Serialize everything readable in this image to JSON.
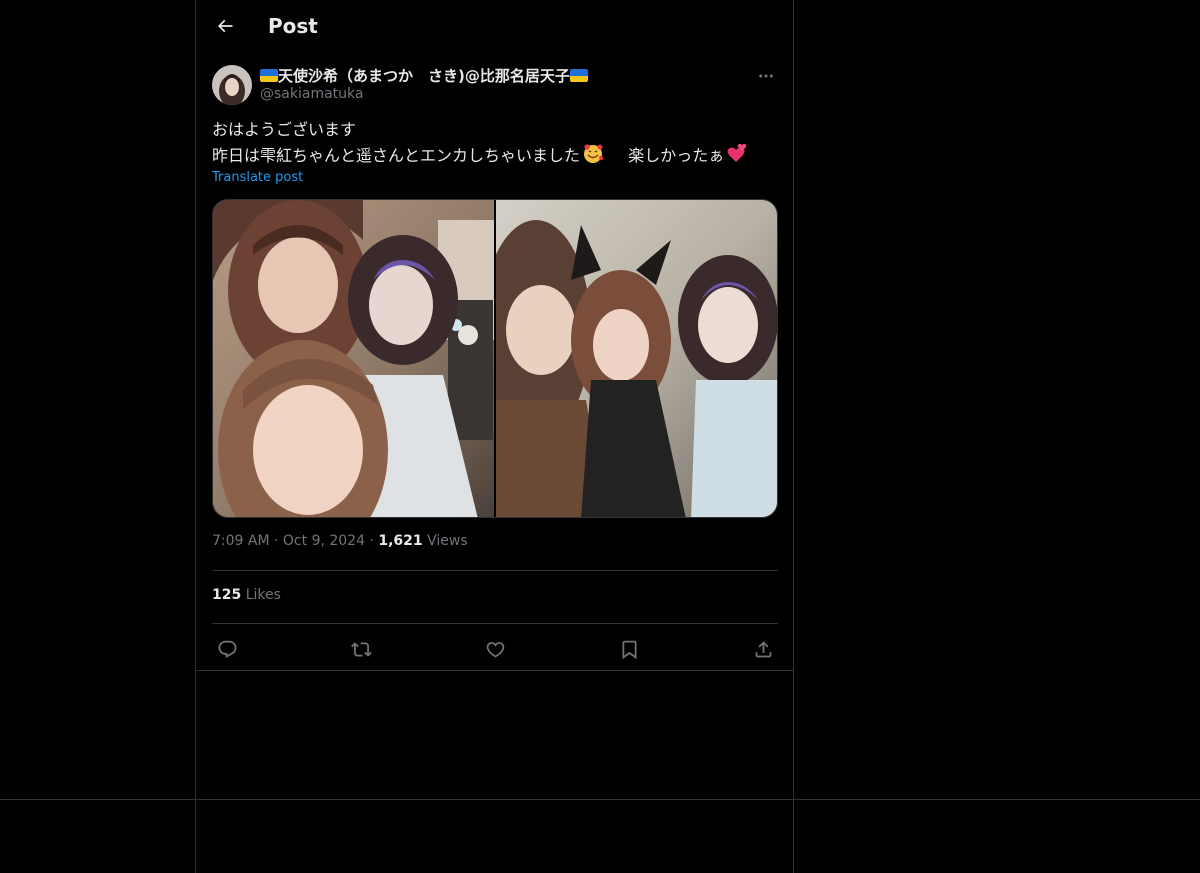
{
  "header": {
    "title": "Post",
    "back_icon": "arrow-left-icon"
  },
  "post": {
    "author": {
      "display_name": "天使沙希（あまつか　さき)@比那名居天子",
      "handle": "@sakiamatuka",
      "flag": "ukraine-flag"
    },
    "text_line1": "おはようございます",
    "text_line2": "昨日は雫紅ちゃんと遥さんとエンカしちゃいました",
    "text_line2_tail": "楽しかったぁ",
    "translate_label": "Translate post",
    "time": "7:09 AM",
    "date": "Oct 9, 2024",
    "views_count": "1,621",
    "views_label": "Views",
    "likes_count": "125",
    "likes_label": "Likes"
  },
  "actions": [
    {
      "name": "reply",
      "icon": "reply-icon"
    },
    {
      "name": "repost",
      "icon": "repost-icon"
    },
    {
      "name": "like",
      "icon": "heart-icon"
    },
    {
      "name": "bookmark",
      "icon": "bookmark-icon"
    },
    {
      "name": "share",
      "icon": "share-icon"
    }
  ],
  "colors": {
    "background": "#000000",
    "border": "#2f3336",
    "text": "#e7e9ea",
    "muted": "#71767b",
    "link": "#1d9bf0"
  }
}
